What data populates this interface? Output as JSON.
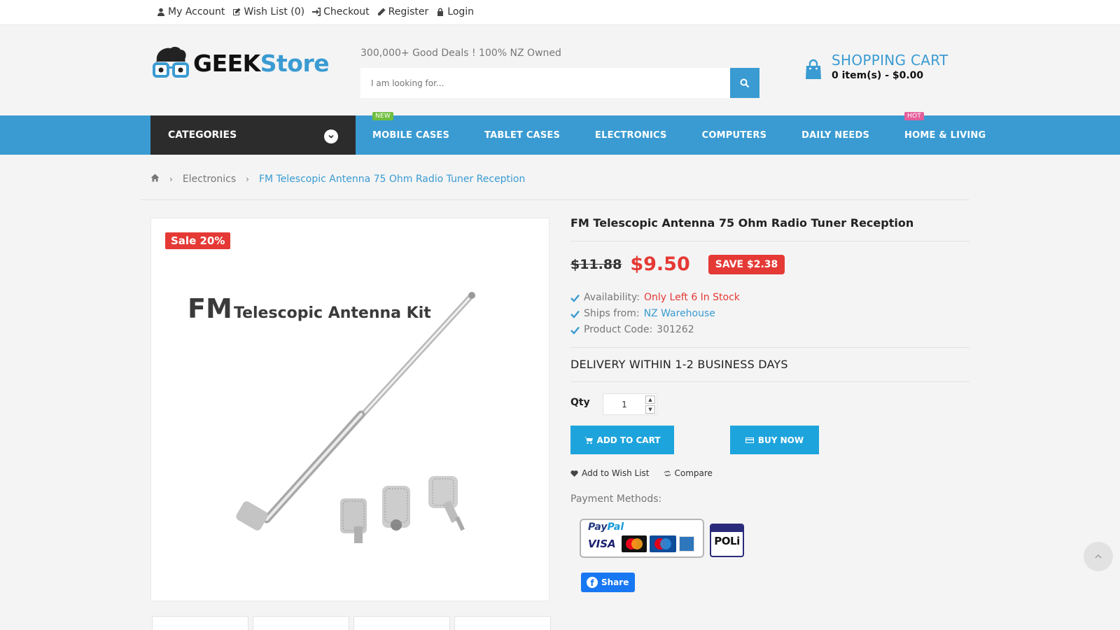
{
  "topbar": {
    "links": [
      {
        "label": "My Account",
        "icon": "user-icon"
      },
      {
        "label": "Wish List (0)",
        "icon": "edit-icon"
      },
      {
        "label": "Checkout",
        "icon": "sign-in-icon"
      },
      {
        "label": "Register",
        "icon": "pencil-icon"
      },
      {
        "label": "Login",
        "icon": "lock-icon"
      }
    ]
  },
  "header": {
    "logo_geek": "GEEK",
    "logo_store": "Store",
    "tagline": "300,000+ Good Deals ! 100% NZ Owned",
    "search_placeholder": "I am looking for...",
    "cart_title": "SHOPPING CART",
    "cart_summary": "0 item(s) - $0.00"
  },
  "nav": {
    "categories_label": "CATEGORIES",
    "items": [
      {
        "label": "MOBILE CASES",
        "badge": "NEW"
      },
      {
        "label": "TABLET CASES",
        "badge": ""
      },
      {
        "label": "ELECTRONICS",
        "badge": ""
      },
      {
        "label": "COMPUTERS",
        "badge": ""
      },
      {
        "label": "DAILY NEEDS",
        "badge": ""
      },
      {
        "label": "HOME & LIVING",
        "badge": "HOT"
      }
    ]
  },
  "breadcrumb": {
    "items": [
      "Electronics",
      "FM Telescopic Antenna 75 Ohm Radio Tuner Reception"
    ]
  },
  "product": {
    "sale_badge": "Sale 20%",
    "image_title_fm": "FM",
    "image_title_rest": "Telescopic Antenna Kit",
    "title": "FM Telescopic Antenna 75 Ohm Radio Tuner Reception",
    "old_price": "$11.88",
    "new_price": "$9.50",
    "save_label": "SAVE $2.38",
    "availability_label": "Availability:",
    "availability_value": "Only Left 6 In Stock",
    "ships_label": "Ships from:",
    "ships_value": "NZ Warehouse",
    "code_label": "Product Code:",
    "code_value": "301262",
    "delivery": "DELIVERY WITHIN 1-2 BUSINESS DAYS",
    "qty_label": "Qty",
    "qty_value": "1",
    "add_to_cart": "ADD TO CART",
    "buy_now": "BUY NOW",
    "wishlist": "Add to Wish List",
    "compare": "Compare",
    "payment_label": "Payment Methods:",
    "paypal_pay": "Pay",
    "paypal_pal": "Pal",
    "visa": "VISA",
    "poli": "POLi",
    "share": "Share"
  },
  "colors": {
    "accent": "#3a9bd2",
    "sale": "#e53935",
    "button": "#1ea4dc",
    "dark": "#2c2c2c"
  }
}
